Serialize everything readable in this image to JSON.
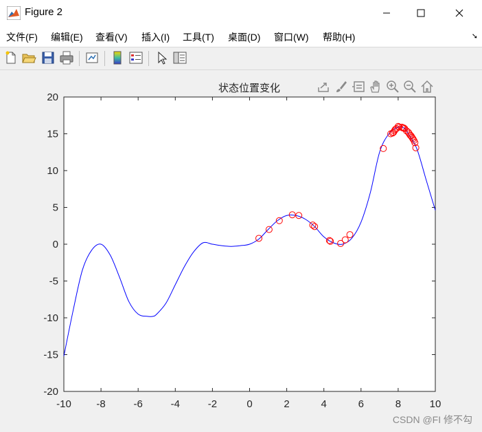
{
  "window": {
    "title": "Figure 2",
    "minimize_label": "—",
    "maximize_label": "☐",
    "close_label": "✕"
  },
  "menu": [
    {
      "label": "文件(F)"
    },
    {
      "label": "编辑(E)"
    },
    {
      "label": "查看(V)"
    },
    {
      "label": "插入(I)"
    },
    {
      "label": "工具(T)"
    },
    {
      "label": "桌面(D)"
    },
    {
      "label": "窗口(W)"
    },
    {
      "label": "帮助(H)"
    }
  ],
  "toolbar": {
    "icons": [
      "new-figure-icon",
      "open-file-icon",
      "save-icon",
      "print-icon",
      "link-plot-icon",
      "colorbar-icon",
      "legend-icon",
      "pointer-icon",
      "property-inspector-icon"
    ]
  },
  "axes_toolbar": {
    "icons": [
      "export-icon",
      "brush-icon",
      "data-tips-icon",
      "pan-icon",
      "zoom-in-icon",
      "zoom-out-icon",
      "home-icon"
    ]
  },
  "colors": {
    "curve": "#0000ff",
    "particles": "#ff0000"
  },
  "watermark": "CSDN @FI 修不勾",
  "chart_data": {
    "type": "line",
    "title": "状态位置变化",
    "xlabel": "",
    "ylabel": "",
    "xlim": [
      -10,
      10
    ],
    "ylim": [
      -20,
      20
    ],
    "xticks": [
      "-10",
      "-8",
      "-6",
      "-4",
      "-2",
      "0",
      "2",
      "4",
      "6",
      "8",
      "10"
    ],
    "yticks": [
      "20",
      "15",
      "10",
      "5",
      "0",
      "-5",
      "-10",
      "-15",
      "-20"
    ],
    "grid": false,
    "series": [
      {
        "style": "line",
        "color": "#0000ff",
        "x": [
          -10,
          -9.5,
          -9,
          -8.5,
          -8,
          -7.5,
          -7,
          -6.5,
          -6,
          -5.5,
          -5.2,
          -5,
          -4.5,
          -4,
          -3.5,
          -3,
          -2.5,
          -2,
          -1.5,
          -1,
          -0.5,
          0,
          0.5,
          1,
          1.5,
          2,
          2.5,
          3,
          3.5,
          4,
          4.5,
          5,
          5.5,
          6,
          6.5,
          7,
          7.5,
          8,
          8.3,
          8.5,
          9,
          9.5,
          10
        ],
        "y": [
          -15.2,
          -9,
          -3.5,
          -0.8,
          0,
          -1.5,
          -4.5,
          -7.8,
          -9.5,
          -9.8,
          -9.8,
          -9.5,
          -8,
          -5.5,
          -3,
          -1,
          0.2,
          0,
          -0.2,
          -0.3,
          -0.2,
          0,
          0.7,
          2,
          3.2,
          3.9,
          3.9,
          3.4,
          2.4,
          1,
          0.2,
          0,
          0.8,
          3,
          7,
          12.5,
          15,
          15.9,
          15.8,
          15.2,
          13,
          8.8,
          4.6
        ]
      },
      {
        "style": "markers",
        "marker": "circle",
        "color": "#ff0000",
        "x": [
          0.5,
          1.05,
          1.6,
          2.3,
          2.65,
          3.4,
          3.5,
          4.3,
          4.35,
          4.9,
          5.15,
          5.4,
          7.2,
          7.6,
          7.7,
          7.75,
          7.8,
          7.85,
          7.9,
          8.0,
          8.05,
          8.2,
          8.25,
          8.3,
          8.35,
          8.45,
          8.55,
          8.6,
          8.65,
          8.7,
          8.75,
          8.8,
          8.85,
          8.9,
          8.95
        ],
        "y": [
          0.8,
          2.0,
          3.2,
          4.0,
          3.9,
          2.6,
          2.4,
          0.5,
          0.4,
          0.1,
          0.6,
          1.3,
          13.0,
          15.0,
          15.1,
          15.2,
          15.4,
          15.6,
          15.7,
          16.0,
          15.9,
          15.9,
          15.8,
          15.8,
          15.7,
          15.4,
          15.2,
          15.0,
          14.8,
          14.7,
          14.5,
          14.3,
          14.1,
          13.8,
          13.1
        ]
      }
    ]
  }
}
